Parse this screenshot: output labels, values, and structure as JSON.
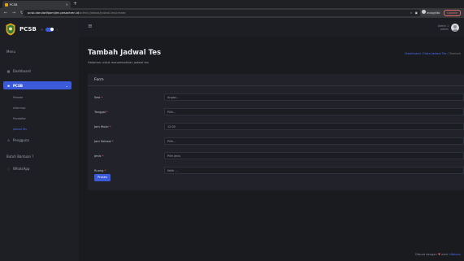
{
  "browser": {
    "tab_title": "PCSB",
    "tab_close": "×",
    "new_tab": "+",
    "url_host": "pcsb.darularifpamijen.pesantren.id",
    "url_path": "/admin/jadwal/jadwal-tes/create",
    "incognito": "Incognito",
    "update": "Update"
  },
  "sidebar": {
    "brand": "PCSB",
    "menu_label": "Menu",
    "items": [
      {
        "label": "Dashboard"
      },
      {
        "label": "PCSB"
      },
      {
        "label": "Pengguna"
      },
      {
        "label": "Butuh Bantuan ?"
      },
      {
        "label": "WhatsApp"
      }
    ],
    "subitems": [
      "Periode",
      "Informasi",
      "Pendaftar",
      "Jadwal Tes"
    ]
  },
  "header": {
    "user_name": "Admin 1",
    "user_role": "admin"
  },
  "page": {
    "title": "Tambah Jadwal Tes",
    "subtitle": "Halaman untuk menambahkan jadwal tes",
    "breadcrumb": [
      "Dashboard",
      "Data Jadwal Tes",
      "Tambah"
    ]
  },
  "form": {
    "header": "Form",
    "fields": [
      {
        "label": "Sesi",
        "value": "Angka..."
      },
      {
        "label": "Tanggal",
        "value": "Pilih..."
      },
      {
        "label": "Jam Mulai",
        "value": "12:00"
      },
      {
        "label": "Jam Selesai",
        "value": "Pilih..."
      },
      {
        "label": "Jenis",
        "value": "Pilih jenis"
      },
      {
        "label": "Ruang",
        "value": "Ketik ..."
      }
    ],
    "submit": "Proses"
  },
  "footer": {
    "text": "Dibuat dengan",
    "by": "oleh",
    "author": "Ulfabian"
  },
  "colors": {
    "accent": "#3b5bdb",
    "required": "#f25c5c",
    "background": "#1a1b1f"
  }
}
